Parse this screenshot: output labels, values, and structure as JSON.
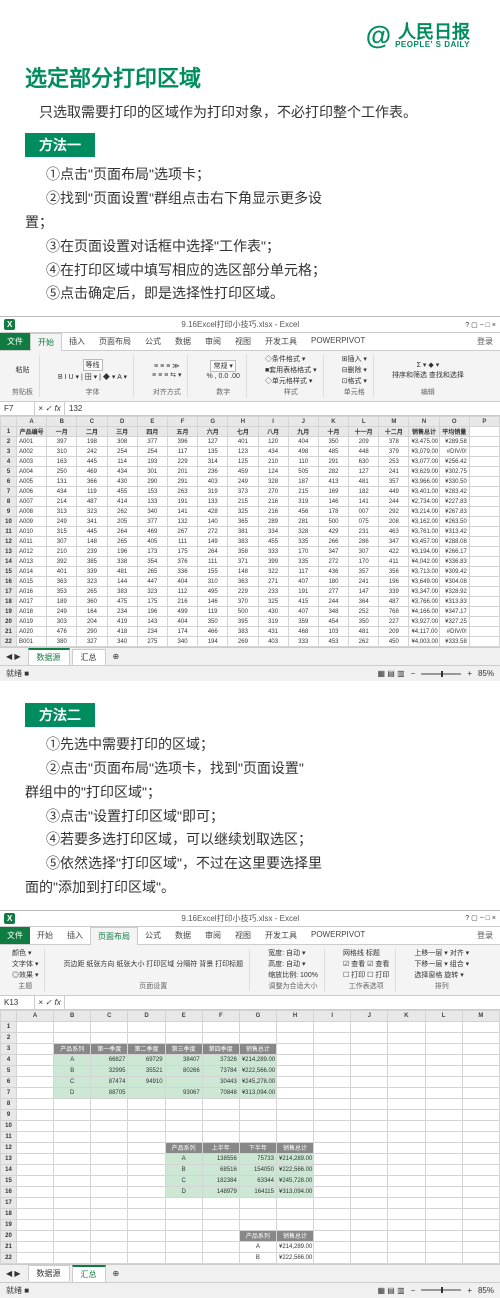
{
  "logo": {
    "at": "@",
    "antenna": "'",
    "name": "人民日报",
    "sub": "PEOPLE' S DAILY"
  },
  "title": "选定部分打印区域",
  "intro": "只选取需要打印的区域作为打印对象，不必打印整个工作表。",
  "method1": {
    "label": "方法一",
    "steps": [
      "①点击\"页面布局\"选项卡；",
      "②找到\"页面设置\"群组点击右下角显示更多设",
      "置；",
      "③在页面设置对话框中选择\"工作表\"；",
      "④在打印区域中填写相应的选区部分单元格；",
      "⑤点击确定后，即是选择性打印区域。"
    ]
  },
  "method2": {
    "label": "方法二",
    "steps": [
      "①先选中需要打印的区域；",
      "②点击\"页面布局\"选项卡，找到\"页面设置\"",
      "群组中的\"打印区域\"；",
      "③点击\"设置打印区域\"即可；",
      "④若要多选打印区域，可以继续划取选区；",
      "⑤依然选择\"打印区域\"，不过在这里要选择里",
      "面的\"添加到打印区域\"。"
    ]
  },
  "excel1": {
    "window_title": "9.16Excel打印小技巧.xlsx - Excel",
    "file_tab": "文件",
    "active_tab": "开始",
    "tabs": [
      "插入",
      "页面布局",
      "公式",
      "数据",
      "审阅",
      "视图",
      "开发工具",
      "POWERPIVOT"
    ],
    "login": "登录",
    "ribbon": {
      "g1_label": "剪贴板",
      "g1_btn": "粘贴",
      "g2_label": "字体",
      "g2_font": "等线",
      "g2_btns": "B  I  U ▾ | 田 ▾ | ◆ ▾ A ▾",
      "g3_label": "对齐方式",
      "g3_line1": "≡ ≡ ≡  ≫",
      "g3_line2": "≡ ≡ ≡  ⇆ ▾",
      "g4_label": "数字",
      "g4_top": "常规 ▾",
      "g4_line": "% , 0.0 .00",
      "g5_label": "样式",
      "g5_a": "◇条件格式 ▾",
      "g5_b": "■套用表格格式 ▾",
      "g5_c": "◇单元格样式 ▾",
      "g6_label": "单元格",
      "g6_a": "⊞插入 ▾",
      "g6_b": "⊟删除 ▾",
      "g6_c": "⊡格式 ▾",
      "g7_label": "编辑",
      "g7_a": "Σ ▾",
      "g7_b": "◆ ▾",
      "g7_c": "◇ ▾",
      "g7_text": "排序和筛选 查找和选择"
    },
    "namebox": "F7",
    "fx_value": "132",
    "cols": [
      "A",
      "B",
      "C",
      "D",
      "E",
      "F",
      "G",
      "H",
      "I",
      "J",
      "K",
      "L",
      "M",
      "N",
      "O",
      "P"
    ],
    "header_row": [
      "产品编号",
      "一月",
      "二月",
      "三月",
      "四月",
      "五月",
      "六月",
      "七月",
      "八月",
      "九月",
      "十月",
      "十一月",
      "十二月",
      "销售总计",
      "平均销量"
    ],
    "rows": [
      [
        "2",
        "A001",
        "397",
        "198",
        "308",
        "377",
        "396",
        "127",
        "401",
        "120",
        "404",
        "350",
        "209",
        "378",
        "¥3,475.00",
        "¥289.58"
      ],
      [
        "3",
        "A002",
        "310",
        "242",
        "254",
        "254",
        "117",
        "135",
        "123",
        "434",
        "498",
        "485",
        "448",
        "379",
        "¥3,079.00",
        "#DIV/0!"
      ],
      [
        "4",
        "A003",
        "163",
        "445",
        "114",
        "193",
        "229",
        "314",
        "125",
        "210",
        "110",
        "291",
        "630",
        "253",
        "¥3,077.00",
        "¥256.42"
      ],
      [
        "5",
        "A004",
        "250",
        "469",
        "434",
        "301",
        "201",
        "236",
        "459",
        "124",
        "505",
        "282",
        "127",
        "241",
        "¥3,629.00",
        "¥302.75"
      ],
      [
        "6",
        "A005",
        "131",
        "366",
        "430",
        "290",
        "291",
        "403",
        "249",
        "328",
        "187",
        "413",
        "481",
        "357",
        "¥3,966.00",
        "¥330.50"
      ],
      [
        "7",
        "A006",
        "434",
        "119",
        "455",
        "153",
        "263",
        "319",
        "373",
        "270",
        "215",
        "169",
        "182",
        "449",
        "¥3,401.00",
        "¥283.42"
      ],
      [
        "8",
        "A007",
        "214",
        "487",
        "414",
        "133",
        "191",
        "133",
        "215",
        "216",
        "319",
        "146",
        "141",
        "244",
        "¥2,734.00",
        "¥227.83"
      ],
      [
        "9",
        "A008",
        "313",
        "323",
        "262",
        "340",
        "141",
        "428",
        "325",
        "216",
        "456",
        "178",
        "007",
        "292",
        "¥3,214.00",
        "¥267.83"
      ],
      [
        "10",
        "A009",
        "249",
        "341",
        "205",
        "377",
        "132",
        "140",
        "365",
        "289",
        "281",
        "500",
        "075",
        "208",
        "¥3,162.00",
        "¥263.50"
      ],
      [
        "11",
        "A010",
        "315",
        "445",
        "264",
        "469",
        "267",
        "272",
        "381",
        "334",
        "328",
        "429",
        "231",
        "463",
        "¥3,761.00",
        "¥313.42"
      ],
      [
        "12",
        "A011",
        "307",
        "148",
        "265",
        "405",
        "111",
        "149",
        "383",
        "455",
        "335",
        "266",
        "286",
        "347",
        "¥3,457.00",
        "¥288.08"
      ],
      [
        "13",
        "A012",
        "210",
        "239",
        "196",
        "173",
        "175",
        "264",
        "358",
        "333",
        "170",
        "347",
        "307",
        "422",
        "¥3,194.00",
        "¥266.17"
      ],
      [
        "14",
        "A013",
        "392",
        "385",
        "338",
        "354",
        "376",
        "111",
        "371",
        "399",
        "335",
        "272",
        "170",
        "411",
        "¥4,042.00",
        "¥336.83"
      ],
      [
        "15",
        "A014",
        "401",
        "339",
        "481",
        "265",
        "336",
        "155",
        "148",
        "322",
        "117",
        "436",
        "357",
        "356",
        "¥3,713.00",
        "¥309.42"
      ],
      [
        "16",
        "A015",
        "363",
        "323",
        "144",
        "447",
        "404",
        "310",
        "363",
        "271",
        "407",
        "180",
        "241",
        "196",
        "¥3,649.00",
        "¥304.08"
      ],
      [
        "17",
        "A016",
        "353",
        "265",
        "383",
        "323",
        "112",
        "495",
        "229",
        "233",
        "191",
        "277",
        "147",
        "339",
        "¥3,347.00",
        "¥328.92"
      ],
      [
        "18",
        "A017",
        "189",
        "360",
        "475",
        "175",
        "216",
        "146",
        "370",
        "325",
        "415",
        "244",
        "364",
        "487",
        "¥3,766.00",
        "¥313.83"
      ],
      [
        "19",
        "A018",
        "249",
        "164",
        "234",
        "196",
        "499",
        "119",
        "500",
        "430",
        "407",
        "348",
        "252",
        "768",
        "¥4,166.00",
        "¥347.17"
      ],
      [
        "20",
        "A019",
        "303",
        "204",
        "419",
        "143",
        "404",
        "350",
        "395",
        "319",
        "359",
        "454",
        "350",
        "227",
        "¥3,927.00",
        "¥327.25"
      ],
      [
        "21",
        "A020",
        "476",
        "290",
        "418",
        "234",
        "174",
        "466",
        "383",
        "431",
        "468",
        "103",
        "481",
        "209",
        "¥4,117.00",
        "#DIV/0!"
      ],
      [
        "22",
        "B001",
        "380",
        "327",
        "340",
        "275",
        "340",
        "194",
        "269",
        "403",
        "333",
        "453",
        "262",
        "450",
        "¥4,003.00",
        "¥333.58"
      ]
    ],
    "sheet_tabs": {
      "active": "数据源",
      "other": "汇总",
      "plus": "⊕"
    },
    "status": {
      "ready": "就绪",
      "rec": "■",
      "zoom": "85%"
    }
  },
  "excel2": {
    "window_title": "9.16Excel打印小技巧.xlsx - Excel",
    "file_tab": "文件",
    "active_tab": "页面布局",
    "tabs": [
      "开始",
      "插入",
      "页面布局",
      "公式",
      "数据",
      "审阅",
      "视图",
      "开发工具",
      "POWERPIVOT"
    ],
    "login": "登录",
    "ribbon": {
      "g1_label": "主题",
      "g1_a": "颜色 ▾",
      "g1_b": "文字体 ▾",
      "g1_c": "◎效果 ▾",
      "g2_label": "页面设置",
      "g2_items": "页边距 纸张方向 纸张大小 打印区域 分隔符 背景 打印标题",
      "g3_label": "调整为合适大小",
      "g3_a": "宽度: 自动 ▾",
      "g3_b": "高度: 自动 ▾",
      "g3_c": "缩放比例: 100%",
      "g4_label": "工作表选项",
      "g4_a": "网格线  标题",
      "g4_b": "☑ 查看  ☑ 查看",
      "g4_c": "☐ 打印  ☐ 打印",
      "g5_label": "排列",
      "g5_a": "上移一层 ▾ 对齐 ▾",
      "g5_b": "下移一层 ▾ 组合 ▾",
      "g5_c": "选择窗格  旋转 ▾"
    },
    "namebox": "K13",
    "fx_value": "",
    "cols": [
      "A",
      "B",
      "C",
      "D",
      "E",
      "F",
      "G",
      "H",
      "I",
      "J",
      "K",
      "L",
      "M"
    ],
    "table1_head": [
      "产品系列",
      "第一季度",
      "第二季度",
      "第三季度",
      "第四季度",
      "销售总计"
    ],
    "table1": [
      [
        "A",
        "66827",
        "69729",
        "38407",
        "37326",
        "¥214,289.00"
      ],
      [
        "B",
        "32995",
        "35521",
        "80266",
        "73784",
        "¥222,566.00"
      ],
      [
        "C",
        "87474",
        "94910",
        "",
        "30443",
        "¥245,278.00"
      ],
      [
        "D",
        "88705",
        "",
        "93067",
        "70848",
        "¥313,094.00"
      ]
    ],
    "table2_head": [
      "产品系列",
      "上半年",
      "下半年",
      "销售总计"
    ],
    "table2": [
      [
        "A",
        "138556",
        "75733",
        "¥214,289.00"
      ],
      [
        "B",
        "68516",
        "154050",
        "¥222,566.00"
      ],
      [
        "C",
        "182384",
        "63344",
        "¥245,728.00"
      ],
      [
        "D",
        "148979",
        "164115",
        "¥313,094.00"
      ]
    ],
    "table3_head": [
      "产品系列",
      "销售总计"
    ],
    "table3": [
      [
        "A",
        "¥214,289.00"
      ],
      [
        "B",
        "¥222,566.00"
      ]
    ],
    "sheet_tabs": {
      "other": "数据源",
      "active": "汇总",
      "plus": "⊕"
    },
    "status": {
      "ready": "就绪",
      "rec": "■",
      "zoom": "85%"
    }
  }
}
